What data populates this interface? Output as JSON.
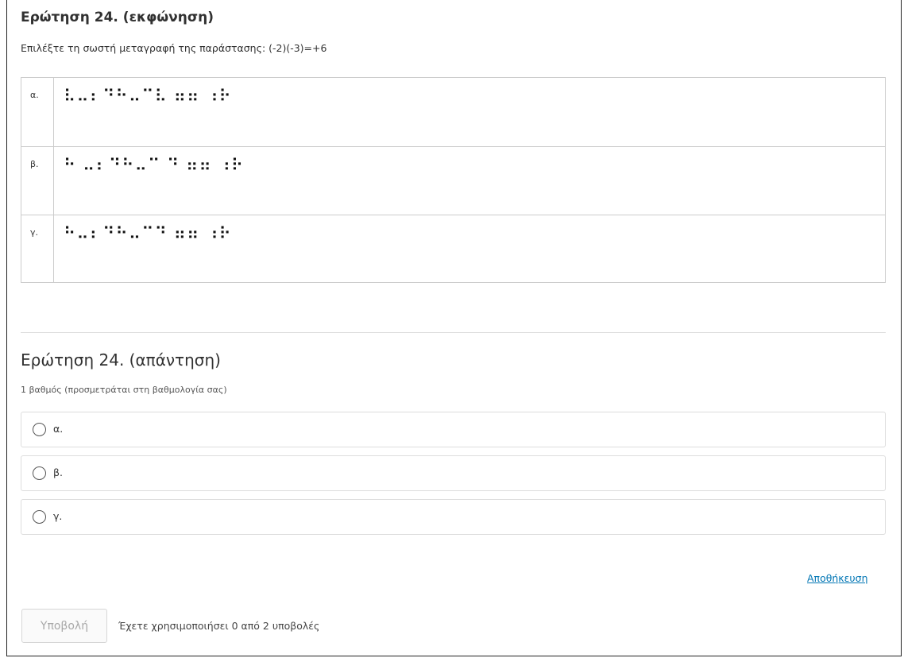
{
  "question": {
    "title": "Ερώτηση 24. (εκφώνηση)",
    "prompt": "Επιλέξτε τη σωστή μεταγραφή της παράστασης: (-2)(-3)=+6",
    "options": [
      {
        "label": "α.",
        "braille": "⠧⠤⠆⠙⠓⠤⠉⠧ ⠶⠶ ⠰⠗"
      },
      {
        "label": "β.",
        "braille": "⠓ ⠤⠆⠙⠓⠤⠉ ⠙ ⠶⠶ ⠰⠗"
      },
      {
        "label": "γ.",
        "braille": "⠓⠤⠆⠙⠓⠤⠉⠙ ⠶⠶ ⠰⠗"
      }
    ]
  },
  "answer": {
    "title": "Ερώτηση 24. (απάντηση)",
    "subtitle": "1 βαθμός (προσμετράται στη βαθμολογία σας)",
    "choices": [
      "α.",
      "β.",
      "γ."
    ]
  },
  "actions": {
    "save_label": "Αποθήκευση",
    "submit_label": "Υποβολή",
    "attempts_text": "Έχετε χρησιμοποιήσει 0 από 2 υποβολές"
  }
}
